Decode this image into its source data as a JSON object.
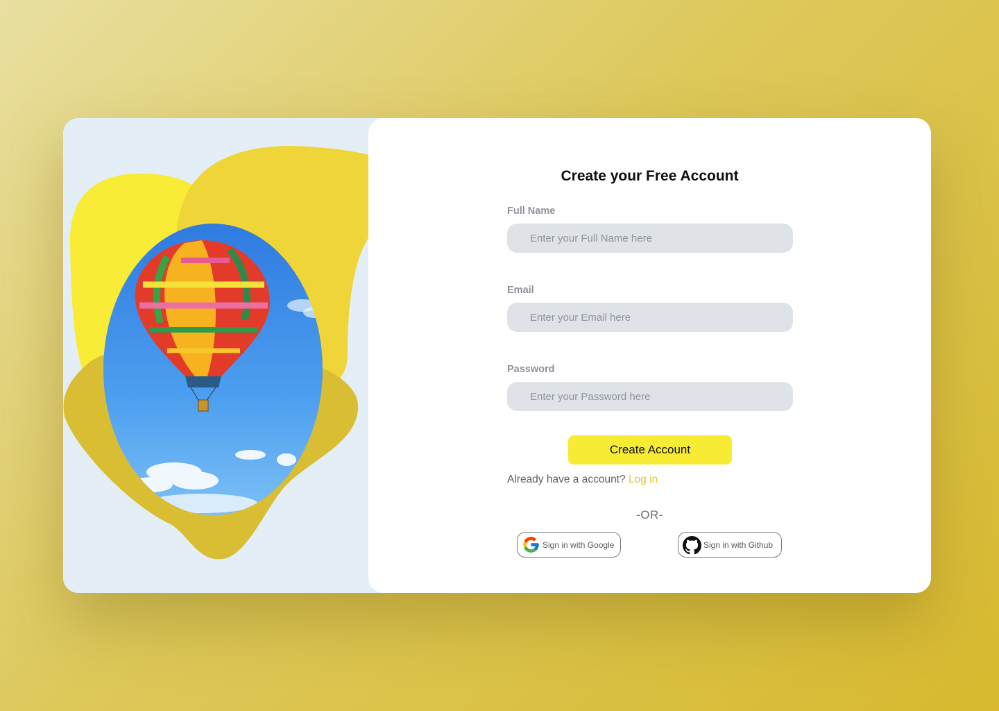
{
  "colors": {
    "accent": "#f7eb33",
    "link": "#e5c51f",
    "blob_light": "#f8ec36",
    "blob_mid": "#f0d539",
    "blob_dark": "#d9be33",
    "panel": "#e4eef6",
    "input_bg": "#dfe2e6"
  },
  "form": {
    "title": "Create your Free Account",
    "fields": [
      {
        "label": "Full Name",
        "placeholder": "Enter your Full Name here"
      },
      {
        "label": "Email",
        "placeholder": "Enter your Email here"
      },
      {
        "label": "Password",
        "placeholder": "Enter your Password here"
      }
    ],
    "submit_label": "Create Account",
    "login_prompt": "Already have a account?",
    "login_link": "Log in",
    "divider": "-OR-"
  },
  "social": {
    "google_label": "Sign in with Google",
    "google_icon": "google-icon",
    "github_label": "Sign in with Github",
    "github_icon": "github-icon"
  },
  "illustration": {
    "subject": "hot-air-balloon-photo"
  }
}
